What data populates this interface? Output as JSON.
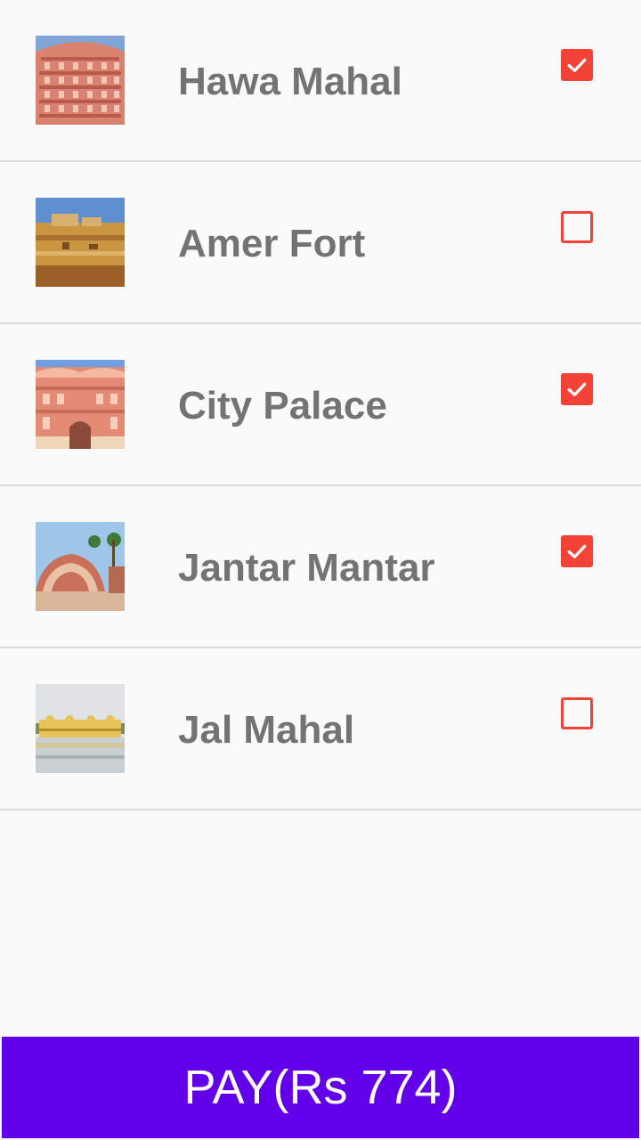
{
  "places": [
    {
      "name": "Hawa Mahal",
      "checked": true,
      "thumb_icon": "hawa-mahal-photo"
    },
    {
      "name": "Amer Fort",
      "checked": false,
      "thumb_icon": "amer-fort-photo"
    },
    {
      "name": "City Palace",
      "checked": true,
      "thumb_icon": "city-palace-photo"
    },
    {
      "name": "Jantar Mantar",
      "checked": true,
      "thumb_icon": "jantar-mantar-photo"
    },
    {
      "name": "Jal Mahal",
      "checked": false,
      "thumb_icon": "jal-mahal-photo"
    }
  ],
  "pay_button": {
    "label": "PAY(Rs 774)"
  },
  "colors": {
    "accent": "#f44336",
    "button": "#6200ea",
    "label_text": "#737373",
    "background": "#fafafa"
  }
}
